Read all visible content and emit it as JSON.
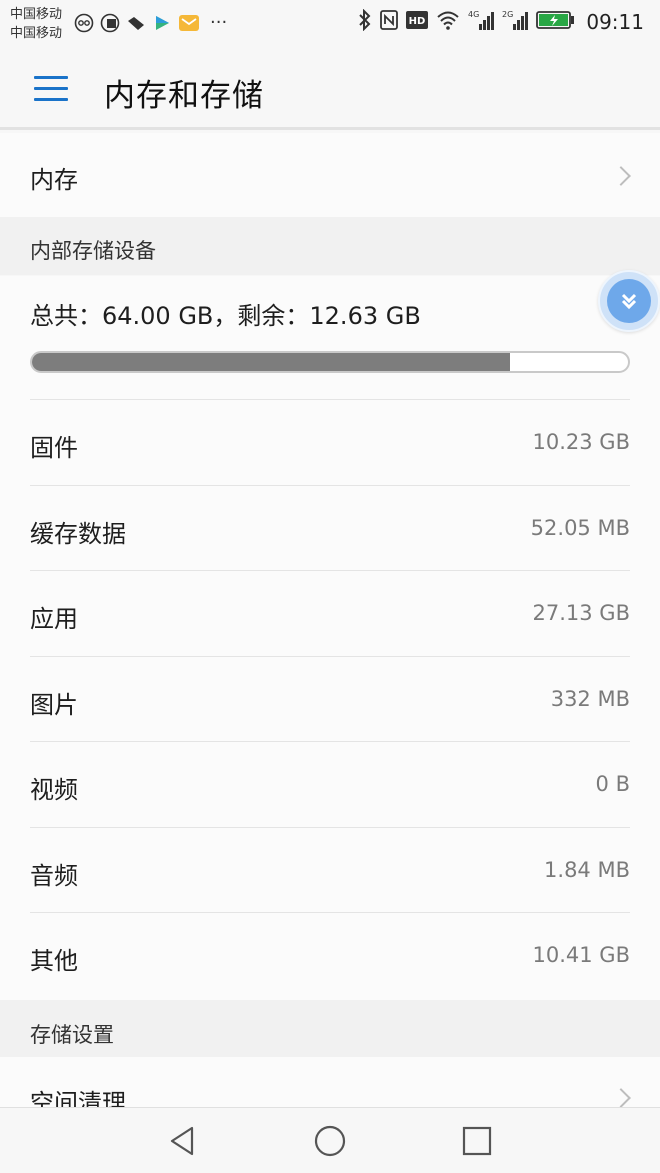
{
  "status_bar": {
    "carrier_1": "中国移动",
    "carrier_2": "中国移动",
    "more": "···",
    "net_1": "4G",
    "net_2": "2G",
    "time": "09:11"
  },
  "app_bar": {
    "title": "内存和存储"
  },
  "memory_row": {
    "label": "内存"
  },
  "internal_section": {
    "header": "内部存储设备",
    "summary": "总共：64.00 GB，剩余：12.63 GB",
    "used_fraction": 0.8027,
    "items": [
      {
        "label": "固件",
        "value": "10.23 GB"
      },
      {
        "label": "缓存数据",
        "value": "52.05 MB"
      },
      {
        "label": "应用",
        "value": "27.13 GB"
      },
      {
        "label": "图片",
        "value": "332 MB"
      },
      {
        "label": "视频",
        "value": "0 B"
      },
      {
        "label": "音频",
        "value": "1.84 MB"
      },
      {
        "label": "其他",
        "value": "10.41 GB"
      }
    ]
  },
  "settings_section": {
    "header": "存储设置",
    "items": [
      {
        "label": "空间清理"
      }
    ]
  },
  "colors": {
    "accent": "#1a73c9",
    "bar_fill": "#7d7d7d",
    "float_button": "#6ea8ea"
  },
  "icons": {
    "menu": "hamburger-icon",
    "chevron": "chevron-right-icon",
    "nav_back": "triangle-back-icon",
    "nav_home": "circle-home-icon",
    "nav_recent": "square-recent-icon"
  }
}
